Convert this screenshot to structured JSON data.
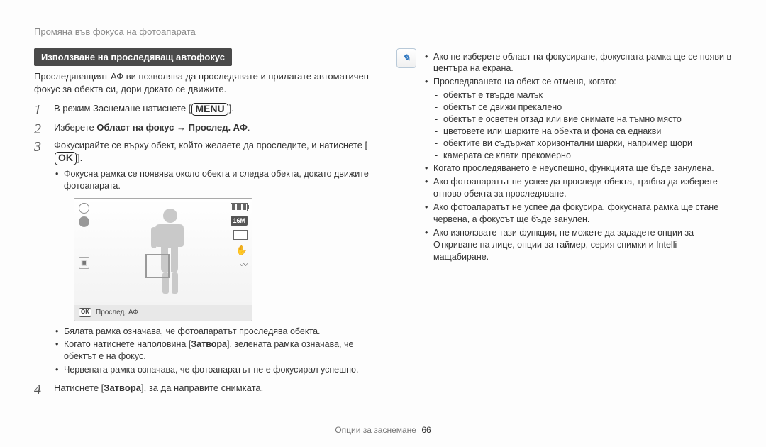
{
  "breadcrumb": "Промяна във фокуса на фотоапарата",
  "left": {
    "section_title": "Използване на проследяващ автофокус",
    "intro": "Проследяващият АФ ви позволява да проследявате и прилагате автоматичен фокус за обекта си, дори докато се движите.",
    "step1_a": "В режим Заснемане натиснете [",
    "step1_btn": "MENU",
    "step1_b": "].",
    "step2_a": "Изберете ",
    "step2_bold": "Област на фокус → Прослед. АФ",
    "step2_b": ".",
    "step3_a": "Фокусирайте се върху обект, който желаете да проследите, и натиснете [",
    "step3_btn": "OK",
    "step3_b": "].",
    "step3_sub1": "Фокусна рамка се появява около обекта и следва обекта, докато движите фотоапарата.",
    "lcd": {
      "tag": "16M",
      "bottom_btn": "OK",
      "bottom_label": "Прослед. АФ"
    },
    "step3_post": {
      "b1": "Бялата рамка означава, че фотоапаратът проследява обекта.",
      "b2_a": "Когато натиснете наполовина [",
      "b2_bold": "Затвора",
      "b2_b": "], зелената рамка означава, че обектът е на фокус.",
      "b3": "Червената рамка означава, че фотоапаратът не е фокусирал успешно."
    },
    "step4_a": "Натиснете [",
    "step4_bold": "Затвора",
    "step4_b": "], за да направите снимката."
  },
  "right": {
    "b1": "Ако не изберете област на фокусиране, фокусната рамка ще се появи в центъра на екрана.",
    "b2": "Проследяването на обект се отменя, когато:",
    "d1": "обектът е твърде малък",
    "d2": "обектът се движи прекалено",
    "d3": "обектът е осветен отзад или вие снимате на тъмно място",
    "d4": "цветовете или шарките на обекта и фона са еднакви",
    "d5": "обектите ви съдържат хоризонтални шарки, например щори",
    "d6": "камерата се клати прекомерно",
    "b3": "Когато проследяването е неуспешно, функцията ще бъде занулена.",
    "b4": "Ако фотоапаратът не успее да проследи обекта, трябва да изберете отново обекта за проследяване.",
    "b5": "Ако фотоапаратът не успее да фокусира, фокусната рамка ще стане червена, а фокусът ще бъде занулен.",
    "b6": "Ако използвате тази функция, не можете да зададете опции за Откриване на лице, опции за таймер, серия снимки и Intelli мащабиране."
  },
  "footer": {
    "label": "Опции за заснемане",
    "page": "66"
  }
}
